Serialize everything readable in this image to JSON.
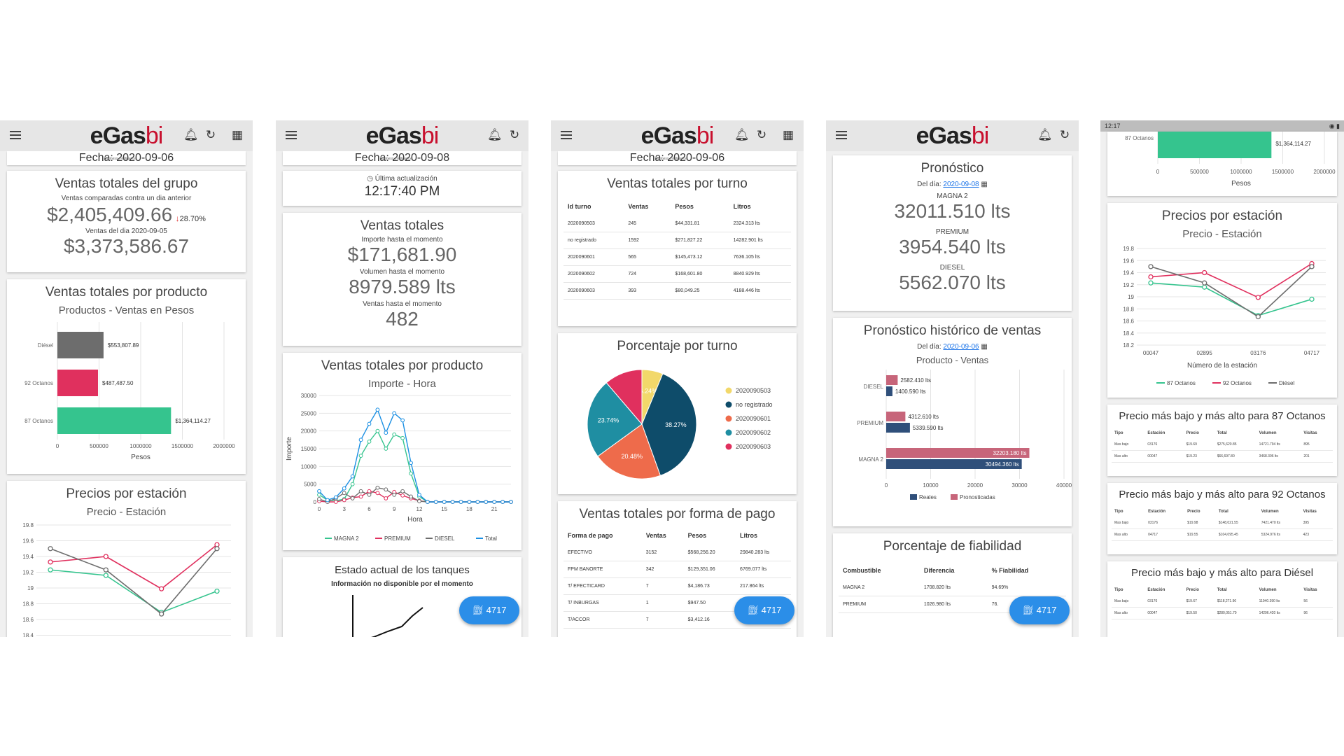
{
  "app": {
    "logo_main": "eGas",
    "logo_bi": "bi",
    "logo_tag": "business intelligence"
  },
  "colors": {
    "green": "#35c48e",
    "pink": "#e0305e",
    "gray": "#6d6d6d",
    "blue": "#1a8fe3",
    "yellow": "#f2d86a",
    "navy": "#0e4c6a",
    "orange": "#ee6b4b",
    "teal": "#1f8ea2",
    "fab": "#2b8ee8"
  },
  "icons": [
    "menu-icon",
    "bell-icon",
    "refresh-icon",
    "calendar-icon",
    "gas-pump-icon",
    "clock-icon"
  ],
  "fab": {
    "label": "4717"
  },
  "s1": {
    "fecha": "Fecha: 2020-09-06",
    "totals": {
      "title": "Ventas totales del grupo",
      "cmp_label": "Ventas comparadas contra un dia anterior",
      "value": "$2,405,409.66",
      "change": "28.70%",
      "prev_label": "Ventas del dia 2020-09-05",
      "prev_value": "$3,373,586.67"
    },
    "product": {
      "title": "Ventas totales por producto",
      "subtitle": "Productos - Ventas en Pesos"
    },
    "precios": {
      "title": "Precios por estación",
      "subtitle": "Precio - Estación"
    }
  },
  "s2": {
    "fecha": "Fecha: 2020-09-08",
    "update_label": "Última actualización",
    "update_time": "12:17:40 PM",
    "totals": {
      "title": "Ventas totales",
      "l1": "Importe hasta el momento",
      "v1": "$171,681.90",
      "l2": "Volumen hasta el momento",
      "v2": "8979.589 lts",
      "l3": "Ventas hasta el momento",
      "v3": "482"
    },
    "product": {
      "title": "Ventas totales por producto",
      "subtitle": "Importe - Hora"
    },
    "tanks": {
      "title": "Estado actual de los tanques",
      "msg": "Información no disponible por el momento"
    }
  },
  "s3": {
    "fecha": "Fecha: 2020-09-06",
    "turno": {
      "title": "Ventas totales por turno",
      "headers": [
        "Id turno",
        "Ventas",
        "Pesos",
        "Litros"
      ],
      "rows": [
        [
          "2020090503",
          "245",
          "$44,331.81",
          "2324.313 lts"
        ],
        [
          "no registrado",
          "1592",
          "$271,827.22",
          "14282.901 lts"
        ],
        [
          "2020090601",
          "565",
          "$145,473.12",
          "7636.105 lts"
        ],
        [
          "2020090602",
          "724",
          "$168,601.80",
          "8840.929 lts"
        ],
        [
          "2020090603",
          "393",
          "$80,049.25",
          "4188.446 lts"
        ]
      ]
    },
    "pct": {
      "title": "Porcentaje por turno"
    },
    "pago": {
      "title": "Ventas totales por forma de pago",
      "headers": [
        "Forma de pago",
        "Ventas",
        "Pesos",
        "Litros"
      ],
      "rows": [
        [
          "EFECTIVO",
          "3152",
          "$568,256.20",
          "29840.283 lts"
        ],
        [
          "FPM BANORTE",
          "342",
          "$129,351.06",
          "6769.077 lts"
        ],
        [
          "T/ EFECTICARD",
          "7",
          "$4,186.73",
          "217.864 lts"
        ],
        [
          "T/ INBURGAS",
          "1",
          "$947.50",
          ""
        ],
        [
          "T/ACCOR",
          "7",
          "$3,412.16",
          ""
        ]
      ]
    }
  },
  "s4": {
    "pron": {
      "title": "Pronóstico",
      "dia_label": "Del día:",
      "dia": "2020-09-08",
      "l1": "MAGNA 2",
      "v1": "32011.510 lts",
      "l2": "PREMIUM",
      "v2": "3954.540 lts",
      "l3": "DIESEL",
      "v3": "5562.070 lts"
    },
    "hist": {
      "title": "Pronóstico histórico de ventas",
      "dia_label": "Del día:",
      "dia": "2020-09-06",
      "subtitle": "Producto - Ventas"
    },
    "fiab": {
      "title": "Porcentaje de fiabilidad",
      "headers": [
        "Combustible",
        "Diferencia",
        "% Fiabilidad"
      ],
      "rows": [
        [
          "MAGNA 2",
          "1708.820 lts",
          "94.69%"
        ],
        [
          "PREMIUM",
          "1026.980 lts",
          "76."
        ]
      ]
    }
  },
  "s5": {
    "status_time": "12:17",
    "top": {
      "value_label": "$1,364,114.27",
      "cat": "87 Octanos",
      "axis_title": "Pesos"
    },
    "precios": {
      "title": "Precios por estación",
      "subtitle": "Precio - Estación",
      "xlabel": "Número de la estación"
    },
    "t87": {
      "title": "Precio más bajo y más alto para 87 Octanos"
    },
    "t92": {
      "title": "Precio más bajo y más alto para 92 Octanos"
    },
    "tdi": {
      "title": "Precio más bajo y más alto para Diésel"
    },
    "tbl_headers": [
      "Tipo",
      "Estación",
      "Precio",
      "Total",
      "Volumen",
      "Visitas"
    ],
    "t87_rows": [
      [
        "Mas bajo",
        "03176",
        "$19.69",
        "$275,620.85",
        "14721.794 lts",
        "895"
      ],
      [
        "Mas alto",
        "00047",
        "$19.23",
        "$66,697.80",
        "3468.396 lts",
        "201"
      ]
    ],
    "t92_rows": [
      [
        "Mas bajo",
        "03176",
        "$19.98",
        "$148,021.55",
        "7421.470 lts",
        "395"
      ],
      [
        "Mas alto",
        "04717",
        "$19.55",
        "$104,095.45",
        "5324.976 lts",
        "423"
      ]
    ],
    "tdi_rows": [
      [
        "Mas bajo",
        "03176",
        "$19.67",
        "$118,271.90",
        "11940.390 lts",
        "56"
      ],
      [
        "Mas alto",
        "00047",
        "$19.50",
        "$280,051.70",
        "14296.420 lts",
        "96"
      ]
    ]
  },
  "chart_data": [
    {
      "type": "bar",
      "orientation": "horizontal",
      "categories": [
        "Diésel",
        "92 Octanos",
        "87 Octanos"
      ],
      "values": [
        553807.89,
        487487.5,
        1364114.27
      ],
      "value_labels": [
        "$553,807.89",
        "$487,487.50",
        "$1,364,114.27"
      ],
      "xlabel": "Pesos",
      "xlim": [
        0,
        2000000
      ],
      "xticks": [
        "0",
        "500000",
        "1000000",
        "1500000",
        "2000000"
      ]
    },
    {
      "type": "line",
      "x": [
        "00047",
        "02895",
        "03176",
        "04717"
      ],
      "ylim": [
        18.2,
        19.8
      ],
      "yticks": [
        "19.8",
        "19.6",
        "19.4",
        "19.2",
        "19",
        "18.8",
        "18.6",
        "18.4",
        "18.2"
      ],
      "series": [
        {
          "name": "87 Octanos",
          "values": [
            19.23,
            19.16,
            18.69,
            18.96
          ]
        },
        {
          "name": "92 Octanos",
          "values": [
            19.33,
            19.4,
            18.99,
            19.55
          ]
        },
        {
          "name": "Diésel",
          "values": [
            19.5,
            19.23,
            18.67,
            19.5
          ]
        }
      ]
    },
    {
      "type": "line",
      "x": [
        0,
        1,
        2,
        3,
        4,
        5,
        6,
        7,
        8,
        9,
        10,
        11,
        12,
        13,
        14,
        15,
        16,
        17,
        18,
        19,
        20,
        21,
        22,
        23
      ],
      "xticks": [
        "0",
        "3",
        "6",
        "9",
        "12",
        "15",
        "18",
        "21"
      ],
      "ylim": [
        0,
        30000
      ],
      "yticks": [
        "30000",
        "25000",
        "20000",
        "15000",
        "10000",
        "5000",
        "0"
      ],
      "xlabel": "Hora",
      "ylabel": "Importe",
      "series": [
        {
          "name": "MAGNA 2",
          "values": [
            2000,
            500,
            300,
            800,
            5000,
            13000,
            17000,
            20000,
            15000,
            19000,
            18000,
            8000,
            1500,
            0,
            0,
            0,
            0,
            0,
            0,
            0,
            0,
            0,
            0,
            0
          ]
        },
        {
          "name": "PREMIUM",
          "values": [
            200,
            0,
            0,
            500,
            1200,
            1500,
            3000,
            2500,
            1000,
            2800,
            1800,
            1000,
            300,
            0,
            0,
            0,
            0,
            0,
            0,
            0,
            0,
            0,
            0,
            0
          ]
        },
        {
          "name": "DIESEL",
          "values": [
            800,
            0,
            1000,
            2500,
            1000,
            3000,
            2000,
            4000,
            3500,
            2000,
            3000,
            1500,
            200,
            0,
            0,
            0,
            0,
            0,
            0,
            0,
            0,
            0,
            0,
            0
          ]
        },
        {
          "name": "Total",
          "values": [
            3000,
            500,
            1300,
            3800,
            7200,
            17500,
            22000,
            26000,
            19500,
            25000,
            23000,
            11000,
            2000,
            0,
            0,
            0,
            0,
            0,
            0,
            0,
            0,
            0,
            0,
            0
          ]
        }
      ]
    },
    {
      "type": "pie",
      "labels": [
        "2020090503",
        "no registrado",
        "2020090601",
        "2020090602",
        "2020090603"
      ],
      "values": [
        6.24,
        38.27,
        20.48,
        23.74,
        11.27
      ],
      "value_labels": [
        "6.24%",
        "38.27%",
        "20.48%",
        "23.74%",
        ""
      ]
    },
    {
      "type": "bar",
      "orientation": "horizontal",
      "categories": [
        "DIESEL",
        "PREMIUM",
        "MAGNA 2"
      ],
      "xlim": [
        0,
        40000
      ],
      "xticks": [
        "0",
        "10000",
        "20000",
        "30000",
        "40000"
      ],
      "series": [
        {
          "name": "Reales",
          "values": [
            1400.59,
            5339.59,
            30494.36
          ],
          "value_labels": [
            "1400.590 lts",
            "5339.590 lts",
            "30494.360 lts"
          ]
        },
        {
          "name": "Pronosticadas",
          "values": [
            2582.41,
            4312.61,
            32203.18
          ],
          "value_labels": [
            "2582.410 lts",
            "4312.610 lts",
            "32203.180 lts"
          ]
        }
      ]
    }
  ]
}
